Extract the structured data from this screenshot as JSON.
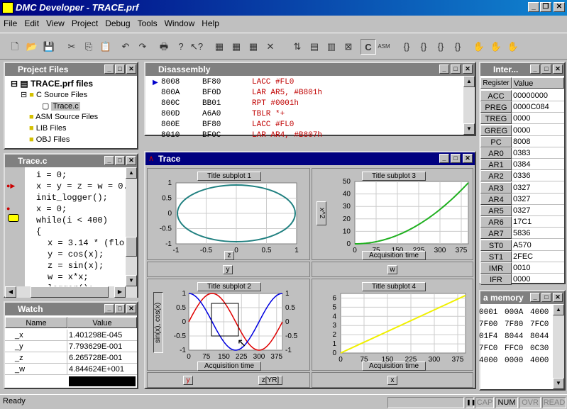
{
  "app": {
    "title": "DMC Developer - TRACE.prf"
  },
  "menu": [
    "File",
    "Edit",
    "View",
    "Project",
    "Debug",
    "Tools",
    "Window",
    "Help"
  ],
  "toolbar": {
    "c_label": "C",
    "asm_label": "ASM"
  },
  "project": {
    "title": "Project Files",
    "root": "TRACE.prf files",
    "items": [
      "C Source Files",
      "Trace.c",
      "ASM Source Files",
      "LIB Files",
      "OBJ Files"
    ]
  },
  "disasm": {
    "title": "Disassembly",
    "rows": [
      {
        "addr": "8008",
        "hex": "BF80",
        "instr": "LACC #FL0"
      },
      {
        "addr": "800A",
        "hex": "BF0D",
        "instr": "LAR AR5, #B801h"
      },
      {
        "addr": "800C",
        "hex": "BB01",
        "instr": "RPT #0001h"
      },
      {
        "addr": "800D",
        "hex": "A6A0",
        "instr": "TBLR *+"
      },
      {
        "addr": "800E",
        "hex": "BF80",
        "instr": "LACC #FL0"
      },
      {
        "addr": "8010",
        "hex": "BF0C",
        "instr": "LAR AR4, #B807h"
      }
    ]
  },
  "source": {
    "title": "Trace.c",
    "lines": [
      "i = 0;",
      "x = y = z = w = 0.",
      "init_logger();",
      "x = 0;",
      "while(i < 400)",
      "{",
      "x = 3.14 * (flo",
      "y = cos(x);",
      "z = sin(x);",
      "w = x*x;",
      "logger();"
    ]
  },
  "watch": {
    "title": "Watch",
    "headers": [
      "Name",
      "Value"
    ],
    "rows": [
      {
        "name": "_x",
        "value": "1.401298E-045"
      },
      {
        "name": "_y",
        "value": "7.793629E-001"
      },
      {
        "name": "_z",
        "value": "6.265728E-001"
      },
      {
        "name": "_w",
        "value": "4.844624E+001"
      }
    ]
  },
  "trace": {
    "title": "Trace",
    "sp1": {
      "title": "Title subplot 1",
      "xlabel": "z",
      "bottom_label": "y",
      "xticks": [
        "-1",
        "-0.5",
        "0",
        "0.5",
        "1"
      ],
      "yticks": [
        "1",
        "0.5",
        "0",
        "-0.5",
        "-1"
      ]
    },
    "sp3": {
      "title": "Title subplot 3",
      "xlabel": "Acquisition time",
      "ylabel": "x^2",
      "bottom_label": "w",
      "xticks": [
        "0",
        "75",
        "150",
        "225",
        "300",
        "375"
      ],
      "yticks": [
        "50",
        "40",
        "30",
        "20",
        "10",
        "0"
      ]
    },
    "sp2": {
      "title": "Title subplot 2",
      "xlabel": "Acquisition time",
      "ylabel": "sin(x), cos(x)",
      "bottom_label_left": "y",
      "bottom_label_right": "z[YR]",
      "xticks": [
        "0",
        "75",
        "150",
        "225",
        "300",
        "375"
      ],
      "yticks": [
        "1",
        "0.5",
        "0",
        "-0.5",
        "-1"
      ]
    },
    "sp4": {
      "title": "Title subplot 4",
      "xlabel": "Acquisition time",
      "bottom_label": "x",
      "xticks": [
        "0",
        "75",
        "150",
        "225",
        "300",
        "375"
      ],
      "yticks": [
        "6",
        "5",
        "4",
        "3",
        "2",
        "1",
        "0"
      ]
    }
  },
  "registers": {
    "title": "Inter...",
    "headers": [
      "Register",
      "Value"
    ],
    "rows": [
      {
        "name": "ACC",
        "value": "00000000"
      },
      {
        "name": "PREG",
        "value": "0000C084"
      },
      {
        "name": "TREG",
        "value": "0000"
      },
      {
        "name": "GREG",
        "value": "0000"
      },
      {
        "name": "PC",
        "value": "8008"
      },
      {
        "name": "AR0",
        "value": "0383"
      },
      {
        "name": "AR1",
        "value": "0384"
      },
      {
        "name": "AR2",
        "value": "0336"
      },
      {
        "name": "AR3",
        "value": "0327"
      },
      {
        "name": "AR4",
        "value": "0327"
      },
      {
        "name": "AR5",
        "value": "0327"
      },
      {
        "name": "AR6",
        "value": "17C1"
      },
      {
        "name": "AR7",
        "value": "5836"
      },
      {
        "name": "ST0",
        "value": "A570"
      },
      {
        "name": "ST1",
        "value": "2FEC"
      },
      {
        "name": "IMR",
        "value": "0010"
      },
      {
        "name": "IFR",
        "value": "0000"
      }
    ]
  },
  "memory": {
    "title": "a memory",
    "rows": [
      [
        "0001",
        "000A",
        "4000"
      ],
      [
        "7F00",
        "7F80",
        "7FC0"
      ],
      [
        "01F4",
        "8044",
        "8044"
      ],
      [
        "7FC0",
        "FFC0",
        "0C30"
      ],
      [
        "4000",
        "0000",
        "4000"
      ]
    ]
  },
  "status": {
    "ready": "Ready",
    "cap": "CAP",
    "num": "NUM",
    "ovr": "OVR",
    "read": "READ"
  },
  "chart_data": [
    {
      "type": "line",
      "title": "Title subplot 1",
      "xlabel": "z",
      "x": [
        -1,
        -0.5,
        0,
        0.5,
        1
      ],
      "series": [
        {
          "values": [
            0,
            0.87,
            1,
            0.87,
            0
          ]
        }
      ],
      "xlim": [
        -1,
        1
      ],
      "ylim": [
        -1,
        1
      ],
      "grid": true
    },
    {
      "type": "line",
      "title": "Title subplot 3",
      "xlabel": "Acquisition time",
      "ylabel": "x^2",
      "x": [
        0,
        75,
        150,
        225,
        300,
        375,
        400
      ],
      "series": [
        {
          "values": [
            0,
            1.7,
            7,
            15.7,
            28,
            43.6,
            49
          ]
        }
      ],
      "xlim": [
        0,
        400
      ],
      "ylim": [
        0,
        50
      ],
      "grid": true
    },
    {
      "type": "line",
      "title": "Title subplot 2",
      "xlabel": "Acquisition time",
      "ylabel": "sin(x), cos(x)",
      "x": [
        0,
        50,
        100,
        150,
        200,
        250,
        300,
        350,
        400
      ],
      "series": [
        {
          "values": [
            0,
            0.71,
            1,
            0.71,
            0,
            -0.71,
            -1,
            -0.71,
            0
          ]
        },
        {
          "values": [
            1,
            0.71,
            0,
            -0.71,
            -1,
            -0.71,
            0,
            0.71,
            1
          ]
        }
      ],
      "xlim": [
        0,
        400
      ],
      "ylim": [
        -1,
        1
      ],
      "grid": true
    },
    {
      "type": "line",
      "title": "Title subplot 4",
      "xlabel": "Acquisition time",
      "x": [
        0,
        400
      ],
      "series": [
        {
          "values": [
            0,
            6.28
          ]
        }
      ],
      "xlim": [
        0,
        400
      ],
      "ylim": [
        0,
        6.5
      ],
      "grid": true
    }
  ]
}
